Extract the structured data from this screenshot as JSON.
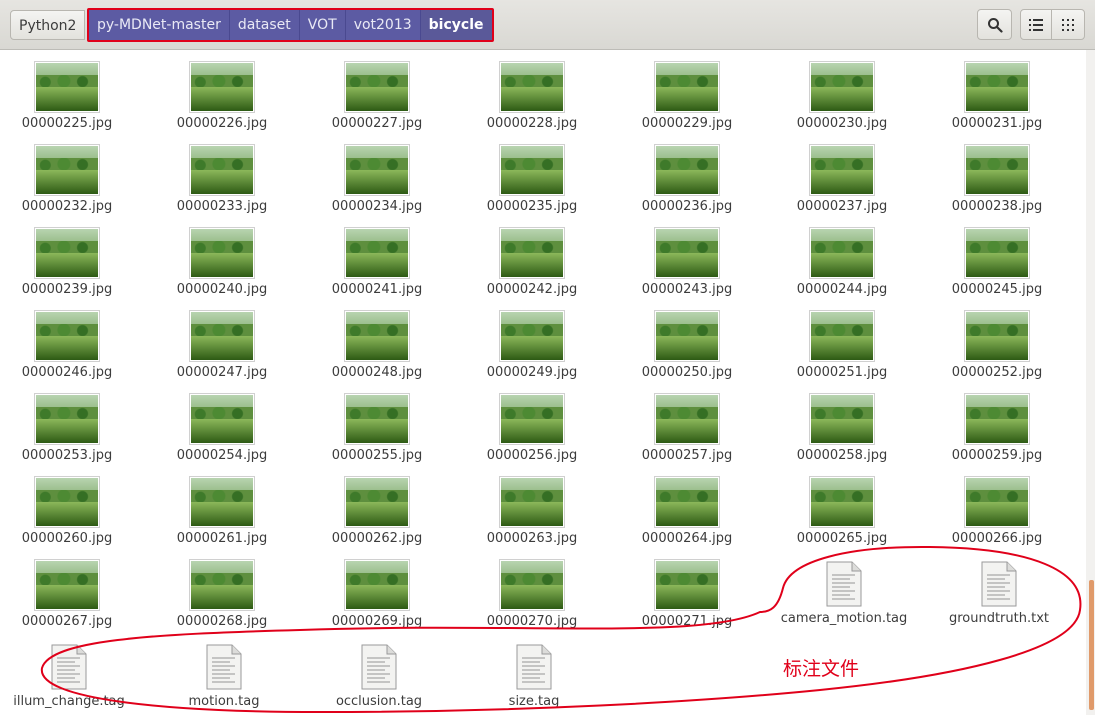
{
  "breadcrumb": {
    "root": "Python2",
    "items": [
      "py-MDNet-master",
      "dataset",
      "VOT",
      "vot2013"
    ],
    "current": "bicycle"
  },
  "toolbar": {
    "search_icon": "search-icon",
    "list_view_icon": "list-view-icon",
    "grid_view_icon": "grid-view-icon"
  },
  "images": [
    "00000225.jpg",
    "00000226.jpg",
    "00000227.jpg",
    "00000228.jpg",
    "00000229.jpg",
    "00000230.jpg",
    "00000231.jpg",
    "00000232.jpg",
    "00000233.jpg",
    "00000234.jpg",
    "00000235.jpg",
    "00000236.jpg",
    "00000237.jpg",
    "00000238.jpg",
    "00000239.jpg",
    "00000240.jpg",
    "00000241.jpg",
    "00000242.jpg",
    "00000243.jpg",
    "00000244.jpg",
    "00000245.jpg",
    "00000246.jpg",
    "00000247.jpg",
    "00000248.jpg",
    "00000249.jpg",
    "00000250.jpg",
    "00000251.jpg",
    "00000252.jpg",
    "00000253.jpg",
    "00000254.jpg",
    "00000255.jpg",
    "00000256.jpg",
    "00000257.jpg",
    "00000258.jpg",
    "00000259.jpg",
    "00000260.jpg",
    "00000261.jpg",
    "00000262.jpg",
    "00000263.jpg",
    "00000264.jpg",
    "00000265.jpg",
    "00000266.jpg",
    "00000267.jpg",
    "00000268.jpg",
    "00000269.jpg",
    "00000270.jpg",
    "00000271.jpg"
  ],
  "files": [
    "camera_motion.tag",
    "groundtruth.txt",
    "illum_change.tag",
    "motion.tag",
    "occlusion.tag",
    "size.tag"
  ],
  "annotation": {
    "label": "标注文件",
    "color": "#e0001a"
  },
  "colors": {
    "breadcrumb_active": "#5c5ba3",
    "highlight": "#e0001a"
  }
}
